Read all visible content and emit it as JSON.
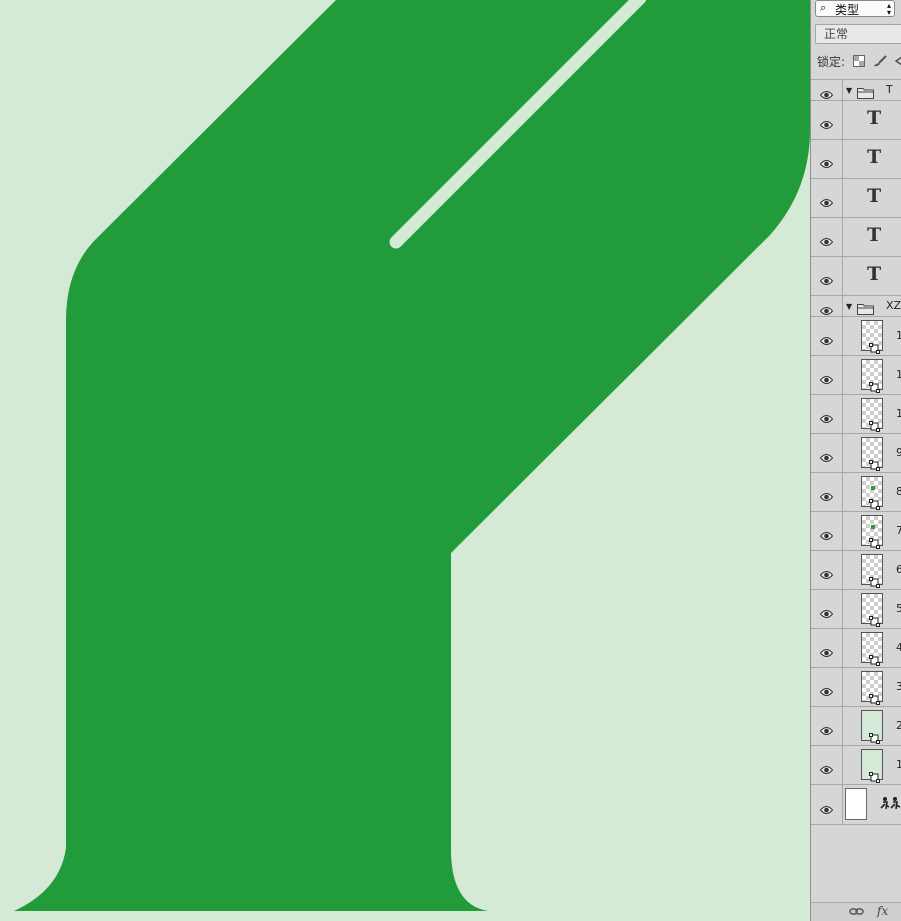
{
  "canvas": {
    "background_color": "#d4e9d6",
    "shape_color": "#229b3a"
  },
  "layers_panel": {
    "filter": {
      "label": "类型",
      "icon": "search-icon"
    },
    "blend_mode": "正常",
    "lock_label": "锁定:",
    "layers": [
      {
        "kind": "group",
        "name": "T",
        "visible": true,
        "expanded": true
      },
      {
        "kind": "text",
        "glyph": "T",
        "visible": true
      },
      {
        "kind": "text",
        "glyph": "T",
        "visible": true
      },
      {
        "kind": "text",
        "glyph": "T",
        "visible": true
      },
      {
        "kind": "text",
        "glyph": "T",
        "visible": true
      },
      {
        "kind": "text",
        "glyph": "T",
        "visible": true
      },
      {
        "kind": "group",
        "name": "XZ",
        "visible": true,
        "expanded": true
      },
      {
        "kind": "shape",
        "name": "1",
        "thumb": "transparent",
        "visible": true
      },
      {
        "kind": "shape",
        "name": "1",
        "thumb": "transparent",
        "visible": true
      },
      {
        "kind": "shape",
        "name": "1",
        "thumb": "transparent",
        "visible": true
      },
      {
        "kind": "shape",
        "name": "9",
        "thumb": "transparent",
        "visible": true
      },
      {
        "kind": "shape",
        "name": "8",
        "thumb": "transparent-dot",
        "visible": true
      },
      {
        "kind": "shape",
        "name": "7",
        "thumb": "transparent-dot",
        "visible": true
      },
      {
        "kind": "shape",
        "name": "6",
        "thumb": "transparent",
        "visible": true
      },
      {
        "kind": "shape",
        "name": "5",
        "thumb": "transparent",
        "visible": true
      },
      {
        "kind": "shape",
        "name": "4",
        "thumb": "transparent",
        "visible": true
      },
      {
        "kind": "shape",
        "name": "3",
        "thumb": "transparent",
        "visible": true
      },
      {
        "kind": "shape",
        "name": "2",
        "thumb": "green",
        "visible": true
      },
      {
        "kind": "shape",
        "name": "1",
        "thumb": "green",
        "visible": true
      },
      {
        "kind": "background",
        "thumb": "white",
        "visible": true
      }
    ],
    "footer": {
      "link_icon": "link-layers-icon",
      "fx_label": "fx"
    }
  }
}
